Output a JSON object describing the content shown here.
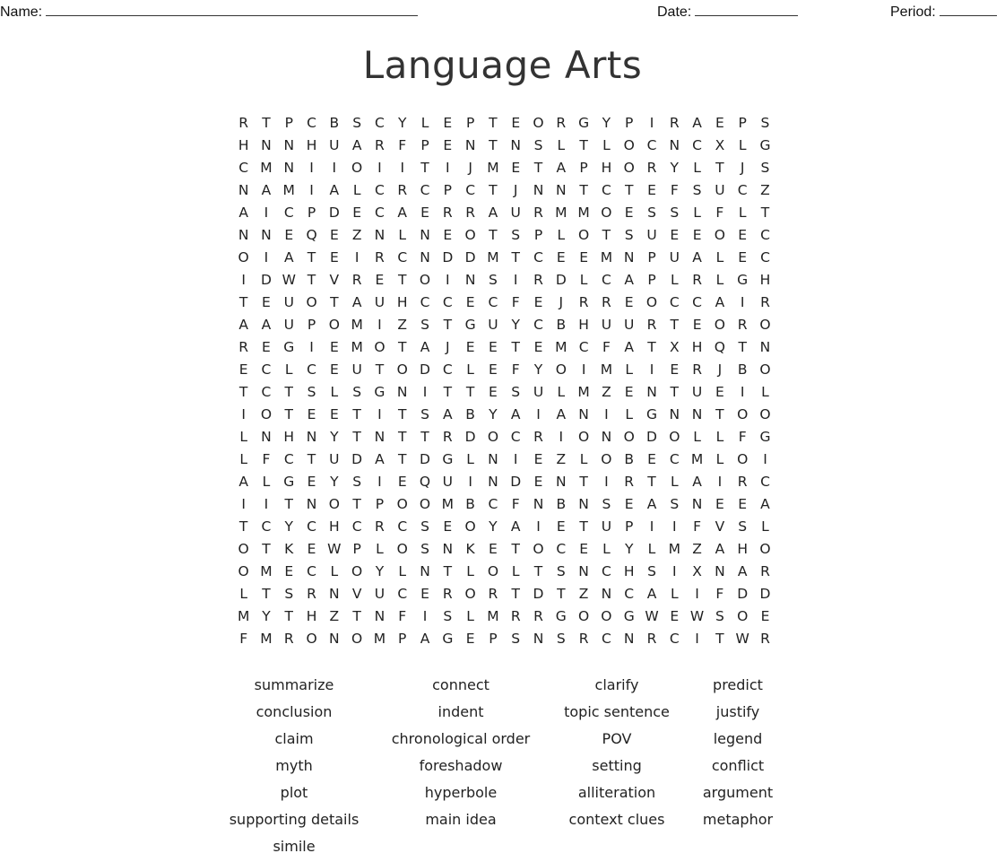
{
  "header": {
    "name_label": "Name:",
    "date_label": "Date:",
    "period_label": "Period:"
  },
  "title": "Language Arts",
  "grid": [
    "RTPCBSCYLEPTEORGYPIRAEPS",
    "HNNHUARFPENTNSLTLOCNCXLG",
    "CMNIIOIITIJMETAPHORYLTJS",
    "NAMIALCRCPCTJNNTCTEFSUCZ",
    "AICPDECAERRAURMMOESSLFLT",
    "NNEQEZNLNEOTSPLOTSUEEOEC",
    "OIATEIRCNDDMTCEEMNPUALEC",
    "IDWTVRETOINSIRDLCAPLRLGH",
    "TEUOTAUHCCECFEJRREOCCAIR",
    "AAUPOMIZSTGUYCBHUURTEORO",
    "REGIEMOTAJEETEMCFATXHQTN",
    "ECLCEUTODCLEFYOIMLIERJBO",
    "TCTSLSGNITTESULMZENTUEIL",
    "IOTEETITSABYAIANILGNNTOO",
    "LNHNYTNTTRDOCRIONODOLLFG",
    "LFCTUDATDGLNIEZLOBECMLOI",
    "ALGEYSIEQUINDENTIRTLAIRC",
    "IITNOTPOOMBCFNBNSEASNEEA",
    "TCYCHCRCSEOYAIETUPIIFVSL",
    "OTKEWPLOSNKETOCELYLMZAHO",
    "OMECLOYLNTLOLTSNCHSIXNAR",
    "LTSRNVUCERORTDTZNCALIFDD",
    "MYTHZTNFISLMRRGOOGWEWSOE",
    "FMRONOMPAGEPSNSRCNRCITWR"
  ],
  "word_rows": [
    [
      "summarize",
      "connect",
      "clarify",
      "predict"
    ],
    [
      "conclusion",
      "indent",
      "topic sentence",
      "justify"
    ],
    [
      "claim",
      "chronological order",
      "POV",
      "legend"
    ],
    [
      "myth",
      "foreshadow",
      "setting",
      "conflict"
    ],
    [
      "plot",
      "hyperbole",
      "alliteration",
      "argument"
    ],
    [
      "supporting details",
      "main idea",
      "context clues",
      "metaphor"
    ],
    [
      "simile"
    ]
  ]
}
